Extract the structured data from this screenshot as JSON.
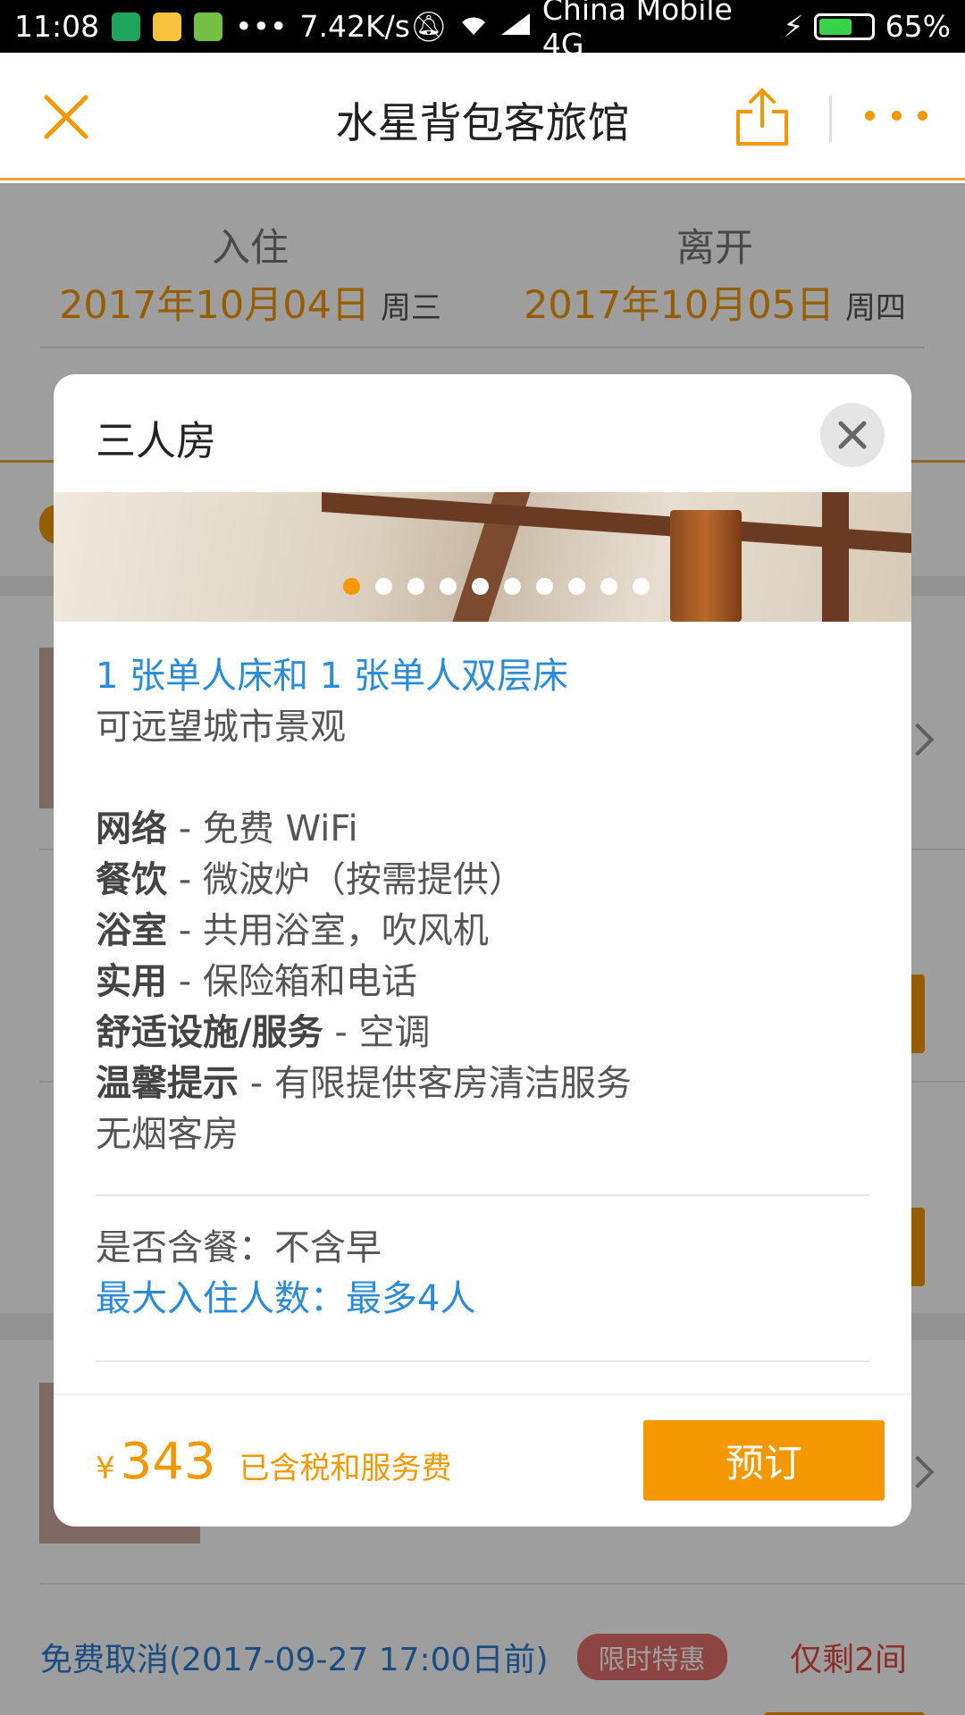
{
  "status_bar": {
    "time": "11:08",
    "speed": "7.42K/s",
    "carrier": "China Mobile 4G",
    "battery": "65%",
    "battery_level": 0.65
  },
  "app_bar": {
    "title": "水星背包客旅馆",
    "icons": [
      "close-icon",
      "share-icon",
      "more-icon"
    ]
  },
  "dates": {
    "checkin": {
      "label": "入住",
      "date": "2017年10月04日",
      "weekday": "周三"
    },
    "checkout": {
      "label": "离开",
      "date": "2017年10月05日",
      "weekday": "周四"
    }
  },
  "background_list": {
    "cancel_text": "免费取消(2017-09-27 17:00日前)",
    "badge": "限时特惠",
    "rooms_left": "仅剩2间",
    "book_label": "预订"
  },
  "modal": {
    "title": "三人房",
    "gallery": {
      "count": 10,
      "active_index": 0
    },
    "bed": "1 张单人床和 1 张单人双层床",
    "view": "可远望城市景观",
    "features": [
      {
        "key": "网络",
        "value": " - 免费 WiFi"
      },
      {
        "key": "餐饮",
        "value": " - 微波炉（按需提供）"
      },
      {
        "key": "浴室",
        "value": " - 共用浴室，吹风机"
      },
      {
        "key": "实用",
        "value": " - 保险箱和电话"
      },
      {
        "key": "舒适设施/服务",
        "value": " - 空调"
      },
      {
        "key": "温馨提示",
        "value": " - 有限提供客房清洁服务"
      }
    ],
    "nonsmoking": "无烟客房",
    "meal": "是否含餐：不含早",
    "max_guests": "最大入住人数：最多4人",
    "price": {
      "currency": "¥",
      "amount": "343",
      "note": "已含税和服务费"
    },
    "book_label": "预订"
  },
  "colors": {
    "accent": "#f39800",
    "link": "#2a8bd8"
  }
}
